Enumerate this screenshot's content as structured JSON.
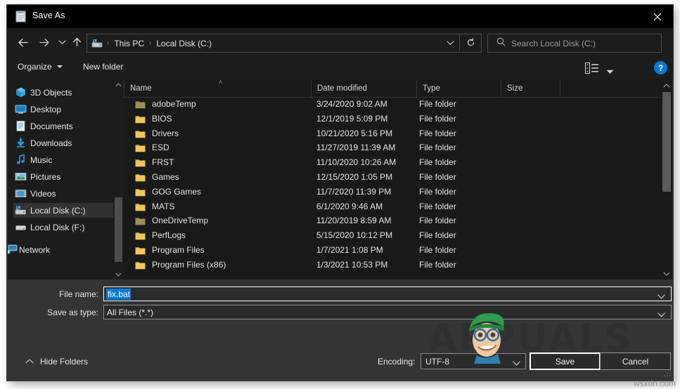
{
  "window": {
    "title": "Save As",
    "title_icon": "notepad-icon",
    "close_label": "✕"
  },
  "nav": {
    "back_icon": "arrow-left-icon",
    "forward_icon": "arrow-right-icon",
    "recent_icon": "chevron-down-icon",
    "up_icon": "arrow-up-icon",
    "address_icon": "drive-icon",
    "breadcrumbs": [
      "This PC",
      "Local Disk (C:)"
    ],
    "separator": "›",
    "dropdown_icon": "chevron-down-icon",
    "refresh_icon": "refresh-icon"
  },
  "search": {
    "icon": "search-icon",
    "placeholder": "Search Local Disk (C:)",
    "value": ""
  },
  "toolbar": {
    "organize_label": "Organize",
    "new_folder_label": "New folder",
    "view_icon": "list-view-icon",
    "view_caret_icon": "chevron-down-icon",
    "help_label": "?",
    "help_icon": "help-icon",
    "accent_color": "#0a7bd4"
  },
  "sidebar": {
    "items": [
      {
        "label": "3D Objects",
        "icon": "3d-objects-icon",
        "selected": false,
        "root": false
      },
      {
        "label": "Desktop",
        "icon": "desktop-icon",
        "selected": false,
        "root": false
      },
      {
        "label": "Documents",
        "icon": "documents-icon",
        "selected": false,
        "root": false
      },
      {
        "label": "Downloads",
        "icon": "downloads-icon",
        "selected": false,
        "root": false
      },
      {
        "label": "Music",
        "icon": "music-icon",
        "selected": false,
        "root": false
      },
      {
        "label": "Pictures",
        "icon": "pictures-icon",
        "selected": false,
        "root": false
      },
      {
        "label": "Videos",
        "icon": "videos-icon",
        "selected": false,
        "root": false
      },
      {
        "label": "Local Disk (C:)",
        "icon": "drive-c-icon",
        "selected": true,
        "root": false
      },
      {
        "label": "Local Disk (F:)",
        "icon": "drive-f-icon",
        "selected": false,
        "root": false
      },
      {
        "label": "Network",
        "icon": "network-icon",
        "selected": false,
        "root": true
      }
    ],
    "scroll_up_icon": "chevron-up-icon",
    "scroll_down_icon": "chevron-down-icon"
  },
  "filelist": {
    "columns": [
      {
        "label": "Name",
        "sorted": true
      },
      {
        "label": "Date modified",
        "sorted": false
      },
      {
        "label": "Type",
        "sorted": false
      },
      {
        "label": "Size",
        "sorted": false
      }
    ],
    "sort_indicator": "˄",
    "rows": [
      {
        "name": "adobeTemp",
        "date": "3/24/2020 9:02 AM",
        "type": "File folder",
        "size": "",
        "icon": "folder-temp-icon"
      },
      {
        "name": "BIOS",
        "date": "12/1/2019 5:09 PM",
        "type": "File folder",
        "size": "",
        "icon": "folder-icon"
      },
      {
        "name": "Drivers",
        "date": "10/21/2020 5:16 PM",
        "type": "File folder",
        "size": "",
        "icon": "folder-icon"
      },
      {
        "name": "ESD",
        "date": "11/27/2019 11:39 AM",
        "type": "File folder",
        "size": "",
        "icon": "folder-icon"
      },
      {
        "name": "FRST",
        "date": "11/10/2020 10:26 AM",
        "type": "File folder",
        "size": "",
        "icon": "folder-icon"
      },
      {
        "name": "Games",
        "date": "12/15/2020 1:05 PM",
        "type": "File folder",
        "size": "",
        "icon": "folder-icon"
      },
      {
        "name": "GOG Games",
        "date": "11/7/2020 11:39 PM",
        "type": "File folder",
        "size": "",
        "icon": "folder-icon"
      },
      {
        "name": "MATS",
        "date": "6/1/2020 9:46 AM",
        "type": "File folder",
        "size": "",
        "icon": "folder-icon"
      },
      {
        "name": "OneDriveTemp",
        "date": "11/20/2019 8:59 AM",
        "type": "File folder",
        "size": "",
        "icon": "folder-temp-icon"
      },
      {
        "name": "PerfLogs",
        "date": "5/15/2020 10:12 PM",
        "type": "File folder",
        "size": "",
        "icon": "folder-icon"
      },
      {
        "name": "Program Files",
        "date": "1/7/2021 1:08 PM",
        "type": "File folder",
        "size": "",
        "icon": "folder-icon"
      },
      {
        "name": "Program Files (x86)",
        "date": "1/3/2021 10:53 PM",
        "type": "File folder",
        "size": "",
        "icon": "folder-icon"
      }
    ],
    "scroll_up_icon": "chevron-up-icon",
    "scroll_down_icon": "chevron-down-icon"
  },
  "form": {
    "filename_label": "File name:",
    "filename_value": "fix.bat",
    "filename_selected": true,
    "savetype_label": "Save as type:",
    "savetype_value": "All Files  (*.*)",
    "dropdown_icon": "chevron-down-icon",
    "selection_color": "#0b7ad4"
  },
  "footer": {
    "hide_folders_label": "Hide Folders",
    "hide_folders_icon": "chevron-up-icon",
    "encoding_label": "Encoding:",
    "encoding_value": "UTF-8",
    "save_label": "Save",
    "cancel_label": "Cancel"
  },
  "watermark": {
    "brand": "APPUALS",
    "site": "wsxdn.com"
  }
}
